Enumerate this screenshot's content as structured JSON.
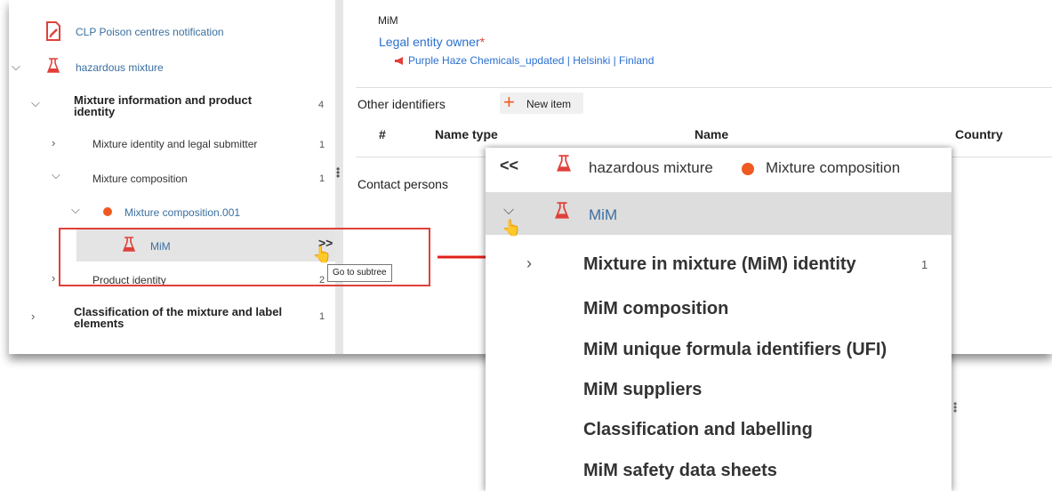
{
  "tree": {
    "root_label": "CLP Poison centres notification",
    "mixture_label": "hazardous mixture",
    "items": [
      {
        "label": "Mixture information and product identity",
        "count": "4"
      },
      {
        "label": "Mixture identity and legal submitter",
        "count": "1"
      },
      {
        "label": "Mixture composition",
        "count": "1"
      },
      {
        "label": "Mixture composition.001"
      },
      {
        "label": "MiM"
      },
      {
        "label": "Product identity",
        "count": "2"
      },
      {
        "label": "Classification of the mixture and label elements",
        "count": "1"
      }
    ],
    "goto_glyph": ">>",
    "tooltip": "Go to subtree"
  },
  "detail": {
    "mim_value": "MiM",
    "legal_entity_label": "Legal entity owner",
    "required_mark": "*",
    "legal_entity_value": "Purple Haze Chemicals_updated | Helsinki | Finland",
    "other_identifiers_label": "Other identifiers",
    "new_item_label": "New item",
    "columns": [
      "#",
      "Name type",
      "Name",
      "Country"
    ],
    "contact_persons_label": "Contact persons"
  },
  "popup": {
    "back_glyph": "<<",
    "breadcrumb_mixture": "hazardous mixture",
    "breadcrumb_composition": "Mixture composition",
    "selected_label": "MiM",
    "items": [
      {
        "label": "Mixture in mixture (MiM) identity",
        "count": "1"
      },
      {
        "label": "MiM composition"
      },
      {
        "label": "MiM unique formula identifiers (UFI)"
      },
      {
        "label": "MiM suppliers"
      },
      {
        "label": "Classification and labelling"
      },
      {
        "label": "MiM safety data sheets"
      }
    ]
  },
  "colors": {
    "accent_orange": "#ee5a22",
    "link_blue": "#3a6fa0",
    "callout_red": "#e0403a",
    "selected_bg": "#dddddd"
  },
  "icons": [
    "document-edit-icon",
    "flask-icon",
    "orange-dot-icon",
    "megaphone-icon",
    "plus-icon",
    "hand-cursor-icon",
    "arrow-right-icon"
  ]
}
